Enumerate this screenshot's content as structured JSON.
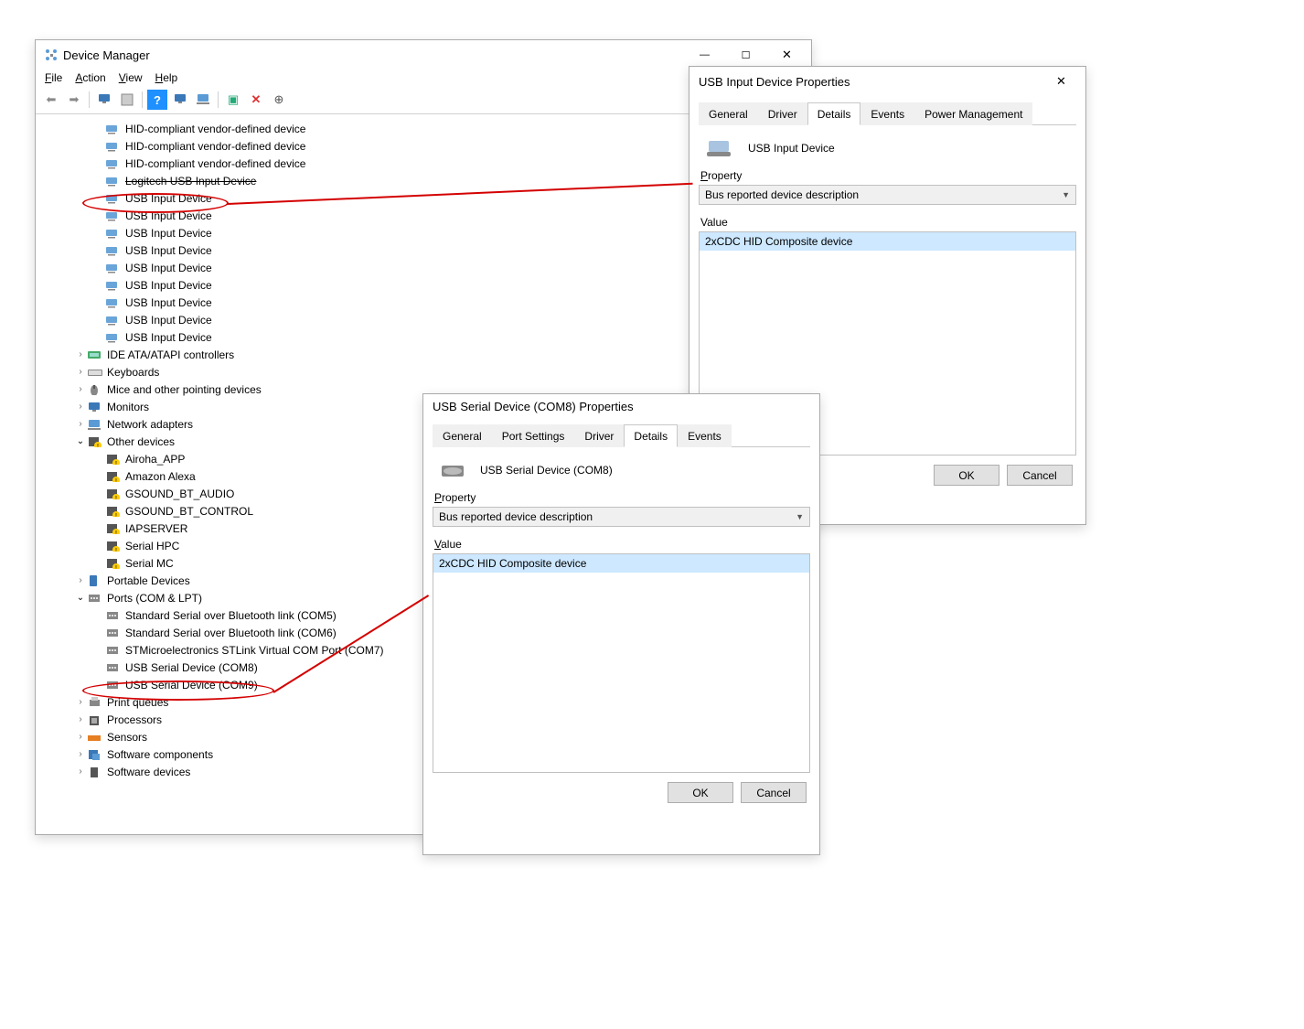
{
  "devmgr": {
    "title": "Device Manager",
    "menu": {
      "file": "File",
      "action": "Action",
      "view": "View",
      "help": "Help"
    },
    "tree": [
      {
        "indent": 3,
        "icon": "hid",
        "label": "HID-compliant vendor-defined device"
      },
      {
        "indent": 3,
        "icon": "hid",
        "label": "HID-compliant vendor-defined device"
      },
      {
        "indent": 3,
        "icon": "hid",
        "label": "HID-compliant vendor-defined device"
      },
      {
        "indent": 3,
        "icon": "hid",
        "label": "Logitech USB Input Device",
        "strike": true
      },
      {
        "indent": 3,
        "icon": "hid",
        "label": "USB Input Device"
      },
      {
        "indent": 3,
        "icon": "hid",
        "label": "USB Input Device"
      },
      {
        "indent": 3,
        "icon": "hid",
        "label": "USB Input Device"
      },
      {
        "indent": 3,
        "icon": "hid",
        "label": "USB Input Device"
      },
      {
        "indent": 3,
        "icon": "hid",
        "label": "USB Input Device"
      },
      {
        "indent": 3,
        "icon": "hid",
        "label": "USB Input Device"
      },
      {
        "indent": 3,
        "icon": "hid",
        "label": "USB Input Device"
      },
      {
        "indent": 3,
        "icon": "hid",
        "label": "USB Input Device"
      },
      {
        "indent": 3,
        "icon": "hid",
        "label": "USB Input Device"
      },
      {
        "indent": 2,
        "icon": "ide",
        "label": "IDE ATA/ATAPI controllers",
        "exp": ">"
      },
      {
        "indent": 2,
        "icon": "kbd",
        "label": "Keyboards",
        "exp": ">"
      },
      {
        "indent": 2,
        "icon": "mouse",
        "label": "Mice and other pointing devices",
        "exp": ">"
      },
      {
        "indent": 2,
        "icon": "monitor",
        "label": "Monitors",
        "exp": ">"
      },
      {
        "indent": 2,
        "icon": "net",
        "label": "Network adapters",
        "exp": ">"
      },
      {
        "indent": 2,
        "icon": "warn",
        "label": "Other devices",
        "exp": "v"
      },
      {
        "indent": 3,
        "icon": "warn",
        "label": "Airoha_APP"
      },
      {
        "indent": 3,
        "icon": "warn",
        "label": "Amazon Alexa"
      },
      {
        "indent": 3,
        "icon": "warn",
        "label": "GSOUND_BT_AUDIO"
      },
      {
        "indent": 3,
        "icon": "warn",
        "label": "GSOUND_BT_CONTROL"
      },
      {
        "indent": 3,
        "icon": "warn",
        "label": "IAPSERVER"
      },
      {
        "indent": 3,
        "icon": "warn",
        "label": "Serial HPC"
      },
      {
        "indent": 3,
        "icon": "warn",
        "label": "Serial MC"
      },
      {
        "indent": 2,
        "icon": "portable",
        "label": "Portable Devices",
        "exp": ">"
      },
      {
        "indent": 2,
        "icon": "port",
        "label": "Ports (COM & LPT)",
        "exp": "v"
      },
      {
        "indent": 3,
        "icon": "port",
        "label": "Standard Serial over Bluetooth link (COM5)"
      },
      {
        "indent": 3,
        "icon": "port",
        "label": "Standard Serial over Bluetooth link (COM6)"
      },
      {
        "indent": 3,
        "icon": "port",
        "label": "STMicroelectronics STLink Virtual COM Port (COM7)"
      },
      {
        "indent": 3,
        "icon": "port",
        "label": "USB Serial Device (COM8)"
      },
      {
        "indent": 3,
        "icon": "port",
        "label": "USB Serial Device (COM9)"
      },
      {
        "indent": 2,
        "icon": "print",
        "label": "Print queues",
        "exp": ">"
      },
      {
        "indent": 2,
        "icon": "cpu",
        "label": "Processors",
        "exp": ">"
      },
      {
        "indent": 2,
        "icon": "sensor",
        "label": "Sensors",
        "exp": ">"
      },
      {
        "indent": 2,
        "icon": "sw",
        "label": "Software components",
        "exp": ">"
      },
      {
        "indent": 2,
        "icon": "sw2",
        "label": "Software devices",
        "exp": ">"
      }
    ]
  },
  "props1": {
    "title": "USB Input Device Properties",
    "tabs": {
      "general": "General",
      "driver": "Driver",
      "details": "Details",
      "events": "Events",
      "power": "Power Management"
    },
    "device_name": "USB Input Device",
    "property_label": "Property",
    "property_value": "Bus reported device description",
    "value_label": "Value",
    "value_item": "2xCDC HID Composite device",
    "ok": "OK",
    "cancel": "Cancel"
  },
  "props2": {
    "title": "USB Serial Device (COM8) Properties",
    "tabs": {
      "general": "General",
      "port": "Port Settings",
      "driver": "Driver",
      "details": "Details",
      "events": "Events"
    },
    "device_name": "USB Serial Device (COM8)",
    "property_label": "Property",
    "property_value": "Bus reported device description",
    "value_label": "Value",
    "value_item": "2xCDC HID Composite device",
    "ok": "OK",
    "cancel": "Cancel"
  }
}
